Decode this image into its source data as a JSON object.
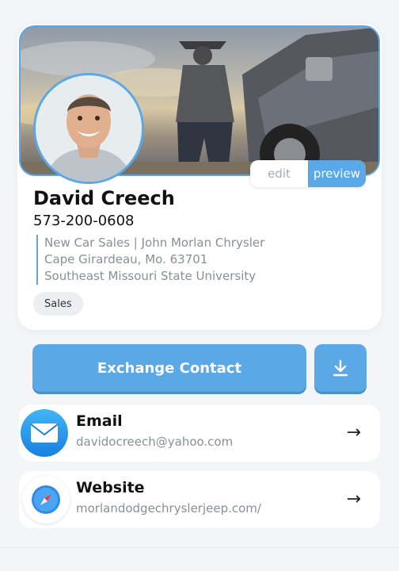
{
  "profile": {
    "name": "David Creech",
    "phone": "573-200-0608",
    "info": [
      "New Car Sales | John Morlan Chrysler",
      "Cape Girardeau, Mo. 63701",
      "Southeast Missouri State University"
    ],
    "tag": "Sales"
  },
  "toggle": {
    "edit": "edit",
    "preview": "preview",
    "active": "preview"
  },
  "actions": {
    "exchange_label": "Exchange Contact"
  },
  "links": [
    {
      "title": "Email",
      "value": "davidocreech@yahoo.com",
      "icon": "mail-icon"
    },
    {
      "title": "Website",
      "value": "morlandodgechryslerjeep.com/",
      "icon": "safari-compass-icon"
    }
  ],
  "colors": {
    "accent": "#5aa8e6",
    "background": "#f4f5f7"
  }
}
